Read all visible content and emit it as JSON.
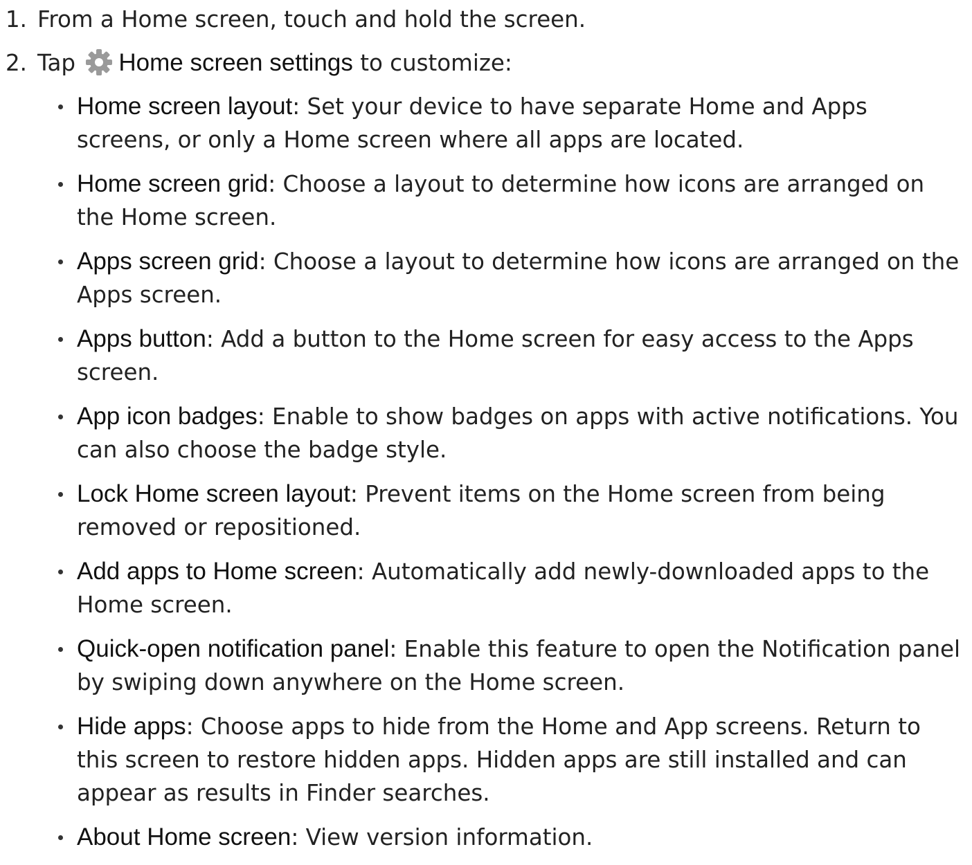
{
  "steps": [
    {
      "number": "1.",
      "text": "From a Home screen, touch and hold the screen."
    },
    {
      "number": "2.",
      "prefix": "Tap",
      "icon": "gear-icon",
      "term": "Home screen settings",
      "suffix": "to customize:"
    }
  ],
  "options": [
    {
      "term": "Home screen layout",
      "desc": ": Set your device to have separate Home and Apps screens, or only a Home screen where all apps are located."
    },
    {
      "term": "Home screen grid",
      "desc": ": Choose a layout to determine how icons are arranged on the Home screen."
    },
    {
      "term": "Apps screen grid",
      "desc": ": Choose a layout to determine how icons are arranged on the Apps screen."
    },
    {
      "term": "Apps button",
      "desc": ": Add a button to the Home screen for easy access to the Apps screen."
    },
    {
      "term": "App icon badges",
      "desc": ": Enable to show badges on apps with active notifications. You can also choose the badge style."
    },
    {
      "term": "Lock Home screen layout",
      "desc": ": Prevent items on the Home screen from being removed or repositioned."
    },
    {
      "term": "Add apps to Home screen",
      "desc": ": Automatically add newly-downloaded apps to the Home screen."
    },
    {
      "term": "Quick-open notification panel",
      "desc": ": Enable this feature to open the Notification panel by swiping down anywhere on the Home screen."
    },
    {
      "term": "Hide apps",
      "desc": ": Choose apps to hide from the Home and App screens. Return to this screen to restore hidden apps. Hidden apps are still installed and can appear as results in Finder searches."
    },
    {
      "term": "About Home screen",
      "desc": ": View version information."
    }
  ],
  "colors": {
    "text": "#222222",
    "gear": "#9a9a9a"
  }
}
